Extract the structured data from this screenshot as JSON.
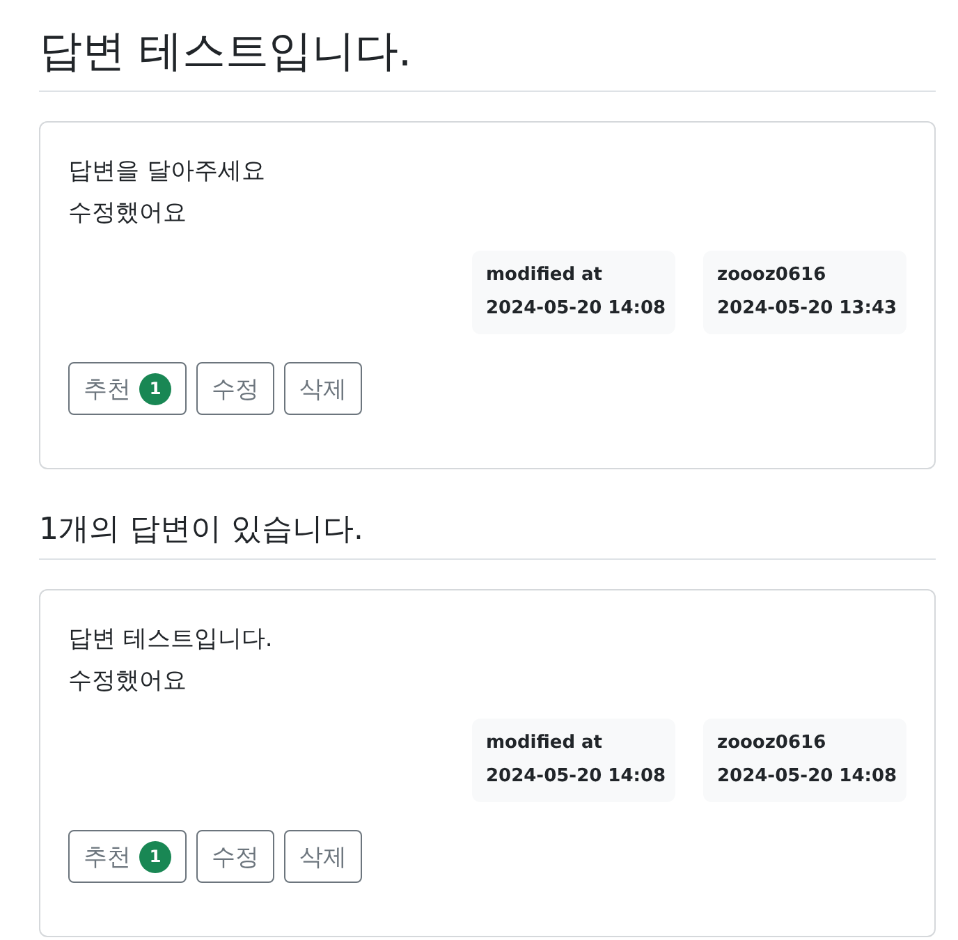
{
  "question": {
    "title": "답변 테스트입니다.",
    "content": [
      "답변을 달아주세요",
      "수정했어요"
    ],
    "meta": [
      {
        "label": "modified at",
        "date": "2024-05-20 14:08"
      },
      {
        "label": "zoooz0616",
        "date": "2024-05-20 13:43"
      }
    ],
    "buttons": [
      {
        "label": "추천",
        "badge": "1"
      },
      {
        "label": "수정"
      },
      {
        "label": "삭제"
      }
    ]
  },
  "answers_heading": "1개의 답변이 있습니다.",
  "answers": [
    {
      "content": [
        "답변 테스트입니다.",
        "수정했어요"
      ],
      "meta": [
        {
          "label": "modified at",
          "date": "2024-05-20 14:08"
        },
        {
          "label": "zoooz0616",
          "date": "2024-05-20 14:08"
        }
      ],
      "buttons": [
        {
          "label": "추천",
          "badge": "1"
        },
        {
          "label": "수정"
        },
        {
          "label": "삭제"
        }
      ]
    }
  ]
}
